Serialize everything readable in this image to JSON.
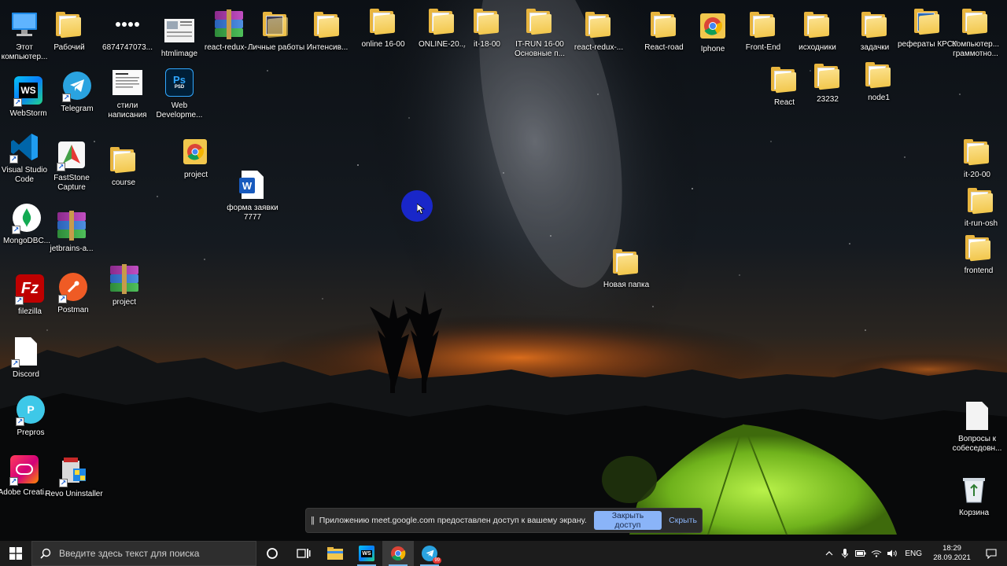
{
  "desktop": {
    "icons": [
      {
        "key": "this-pc",
        "label": "Этот компьютер..."
      },
      {
        "key": "rabochiy",
        "label": "Рабочий"
      },
      {
        "key": "num-file",
        "label": "6874747073..."
      },
      {
        "key": "htmlimage",
        "label": "htmlimage"
      },
      {
        "key": "react-redux-arch",
        "label": "react-redux-..."
      },
      {
        "key": "lichnye",
        "label": "Личные работы"
      },
      {
        "key": "intensiv",
        "label": "Интенсив..."
      },
      {
        "key": "online1600",
        "label": "online 16-00"
      },
      {
        "key": "online20",
        "label": "ONLINE-20..."
      },
      {
        "key": "it1800",
        "label": "it-18-00"
      },
      {
        "key": "itrun1600",
        "label": "IT-RUN 16-00 Основные п..."
      },
      {
        "key": "react-redux-folder",
        "label": "react-redux-..."
      },
      {
        "key": "react-road",
        "label": "React-road"
      },
      {
        "key": "iphone",
        "label": "Iphone"
      },
      {
        "key": "front-end",
        "label": "Front-End"
      },
      {
        "key": "ishodniki",
        "label": "исходники"
      },
      {
        "key": "zadachki",
        "label": "задачки"
      },
      {
        "key": "referaty",
        "label": "рефераты КРСУ"
      },
      {
        "key": "kompyuter",
        "label": "Компьютер... граммотно..."
      },
      {
        "key": "react",
        "label": "React"
      },
      {
        "key": "f23232",
        "label": "23232"
      },
      {
        "key": "node1",
        "label": "node1"
      },
      {
        "key": "webstorm",
        "label": "WebStorm"
      },
      {
        "key": "telegram",
        "label": "Telegram"
      },
      {
        "key": "stili",
        "label": "стили написания"
      },
      {
        "key": "webdev",
        "label": "Web Developme..."
      },
      {
        "key": "vscode",
        "label": "Visual Studio Code"
      },
      {
        "key": "faststone",
        "label": "FastStone Capture"
      },
      {
        "key": "course",
        "label": "course"
      },
      {
        "key": "project-chrome",
        "label": "project"
      },
      {
        "key": "forma",
        "label": "форма заявки 7777"
      },
      {
        "key": "mongodb",
        "label": "MongoDBC..."
      },
      {
        "key": "jetbrains",
        "label": "jetbrains-a..."
      },
      {
        "key": "filezilla",
        "label": "filezilla"
      },
      {
        "key": "postman",
        "label": "Postman"
      },
      {
        "key": "project-rar",
        "label": "project"
      },
      {
        "key": "novaya",
        "label": "Новая папка"
      },
      {
        "key": "discord",
        "label": "Discord"
      },
      {
        "key": "prepros",
        "label": "Prepros"
      },
      {
        "key": "adobe",
        "label": "Adobe Creati..."
      },
      {
        "key": "revo",
        "label": "Revo Uninstaller"
      },
      {
        "key": "it2000",
        "label": "it-20-00"
      },
      {
        "key": "itrunosh",
        "label": "it-run-osh"
      },
      {
        "key": "frontend",
        "label": "frontend"
      },
      {
        "key": "voprosy",
        "label": "Вопросы к собеседовн..."
      },
      {
        "key": "korzina",
        "label": "Корзина"
      }
    ]
  },
  "share_bar": {
    "pause_glyph": "||",
    "message": "Приложению meet.google.com предоставлен доступ к вашему экрану.",
    "stop_label": "Закрыть доступ",
    "hide_label": "Скрыть"
  },
  "taskbar": {
    "search_placeholder": "Введите здесь текст для поиска",
    "telegram_badge": "99",
    "lang": "ENG",
    "time": "18:29",
    "date": "28.09.2021"
  },
  "colors": {
    "taskbar_bg": "#1c1c1c",
    "accent": "#8ab4f8",
    "cursor_halo": "#1a28d8"
  }
}
